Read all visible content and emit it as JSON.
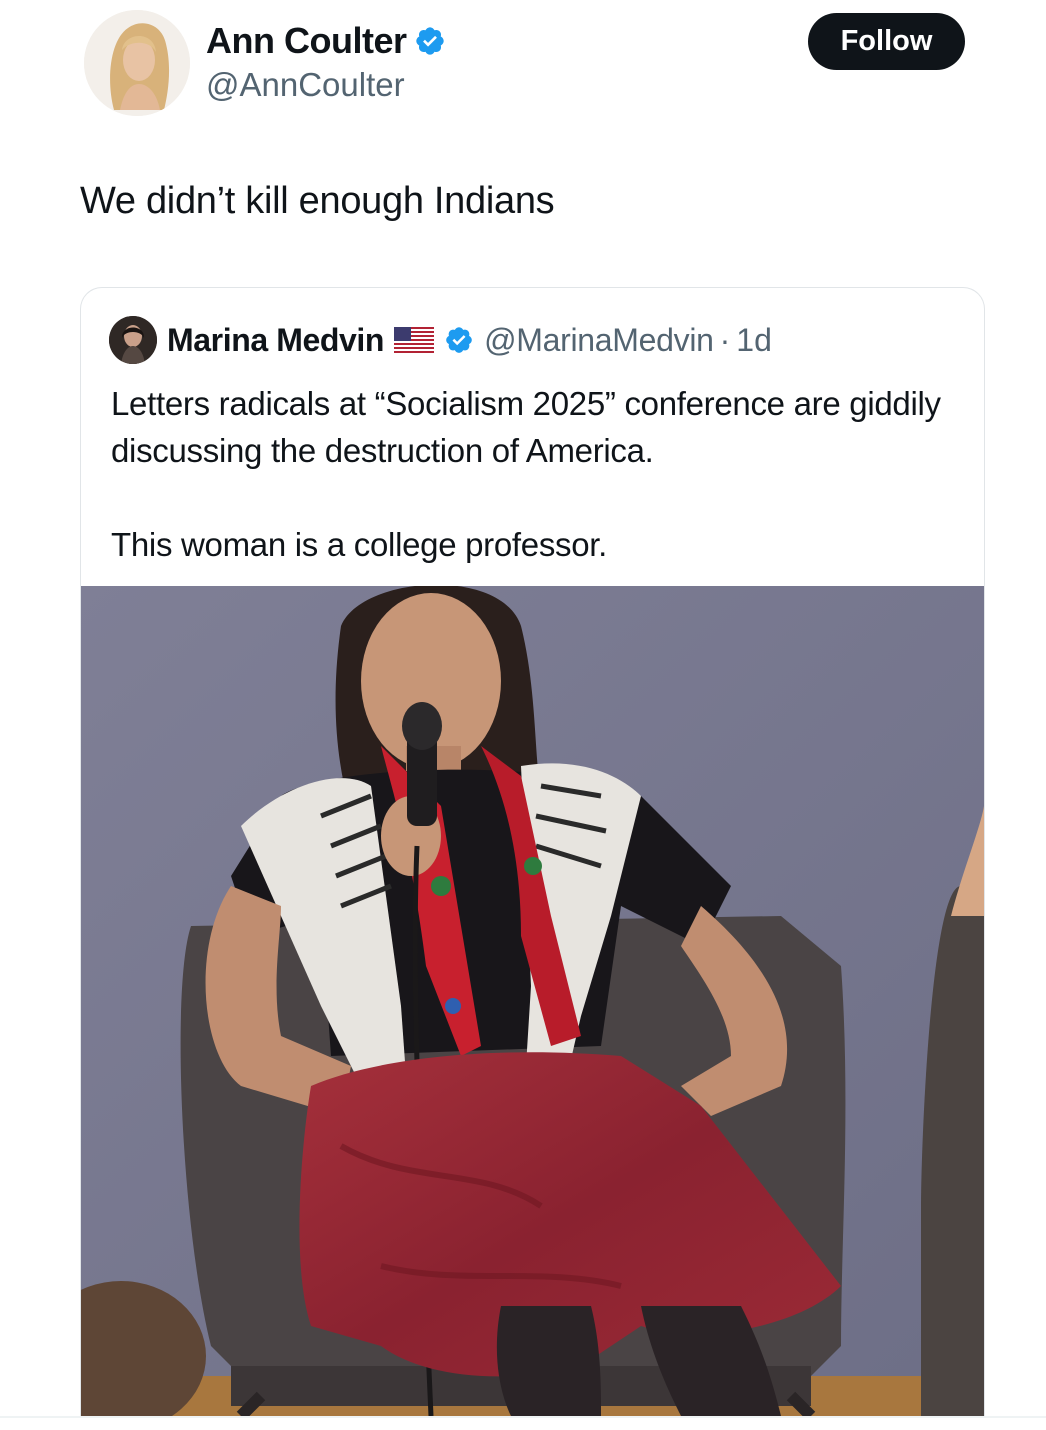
{
  "tweet": {
    "author": {
      "name": "Ann Coulter",
      "handle": "@AnnCoulter",
      "verified_icon": "verified-badge-icon"
    },
    "follow_label": "Follow",
    "text": "We didn’t kill enough Indians"
  },
  "quote": {
    "author": {
      "name": "Marina Medvin",
      "flag_icon": "us-flag-icon",
      "verified_icon": "verified-badge-icon",
      "handle": "@MarinaMedvin",
      "separator": "·",
      "time": "1d"
    },
    "paragraphs": [
      "Letters radicals at “Socialism 2025” conference are giddily discussing the destruction of America.",
      "This woman is a college professor."
    ]
  },
  "colors": {
    "text_primary": "#0f1419",
    "text_secondary": "#536471",
    "verified_blue": "#1d9bf0",
    "follow_bg": "#0f1419",
    "follow_text": "#ffffff",
    "card_border": "#e1e5e8"
  }
}
